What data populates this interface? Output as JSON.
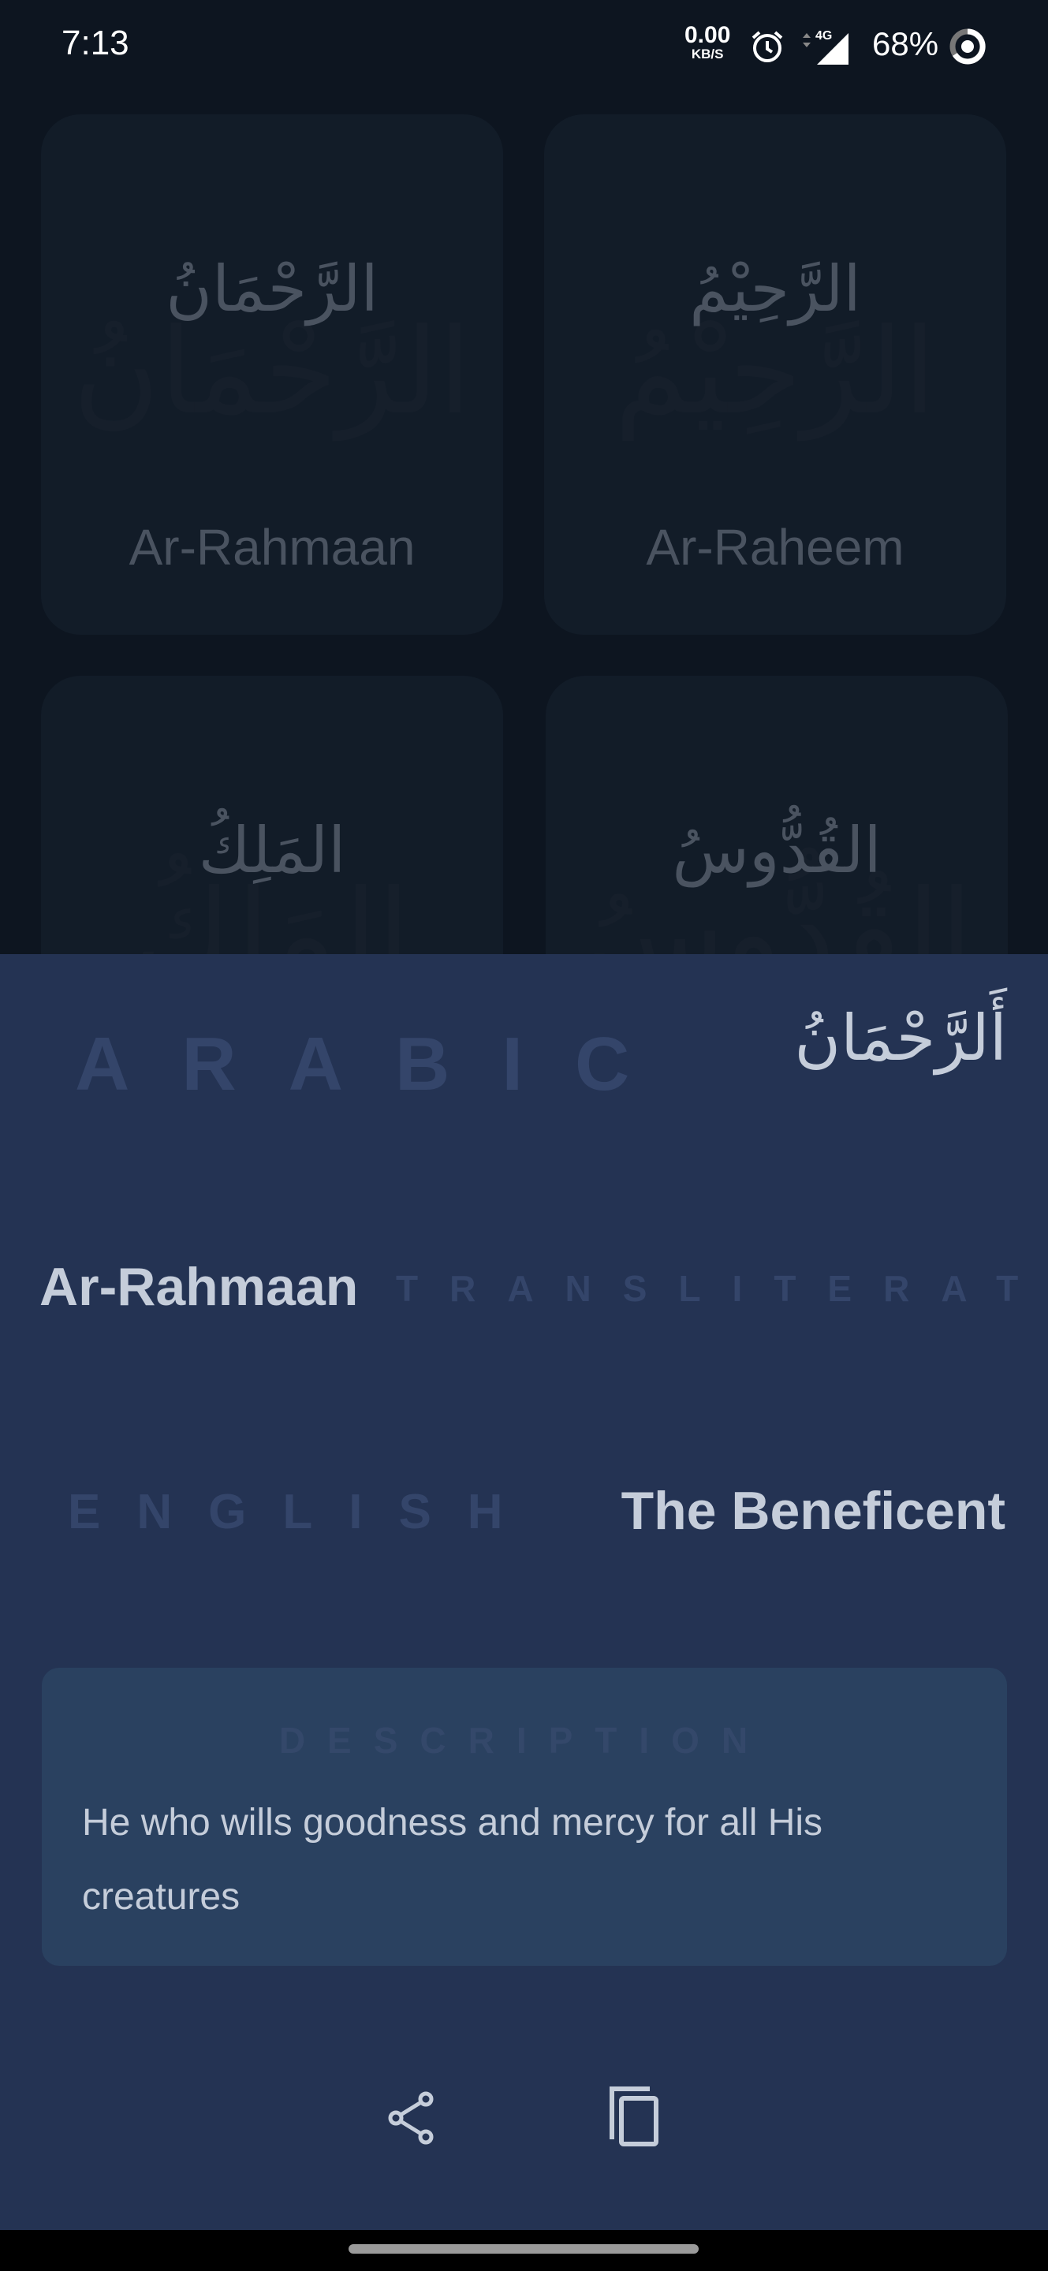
{
  "status_bar": {
    "time": "7:13",
    "net_speed": "0.00",
    "net_unit": "KB/S",
    "network": "4G",
    "battery": "68%"
  },
  "grid": [
    {
      "arabic": "الرَّحْمَانُ",
      "transliteration": "Ar-Rahmaan"
    },
    {
      "arabic": "الرَّحِيْمُ",
      "transliteration": "Ar-Raheem"
    },
    {
      "arabic": "المَلِكُ",
      "transliteration": ""
    },
    {
      "arabic": "القُدُّوسُ",
      "transliteration": ""
    }
  ],
  "detail": {
    "arabic_label": "ARABIC",
    "arabic": "أَلرَّحْمَانُ",
    "transliteration": "Ar-Rahmaan",
    "transliteration_label": "TRANSLITERATION",
    "english_label": "ENGLISH",
    "english": "The Beneficent",
    "description_label": "DESCRIPTION",
    "description": "He who wills goodness and mercy for all His creatures"
  },
  "actions": {
    "share": "share-icon",
    "copy": "copy-icon"
  },
  "colors": {
    "background": "#0d1520",
    "card": "#121c28",
    "sheet": "#243353",
    "description_box": "#2a4160",
    "text": "#c5cdda",
    "label": "#34456a"
  }
}
